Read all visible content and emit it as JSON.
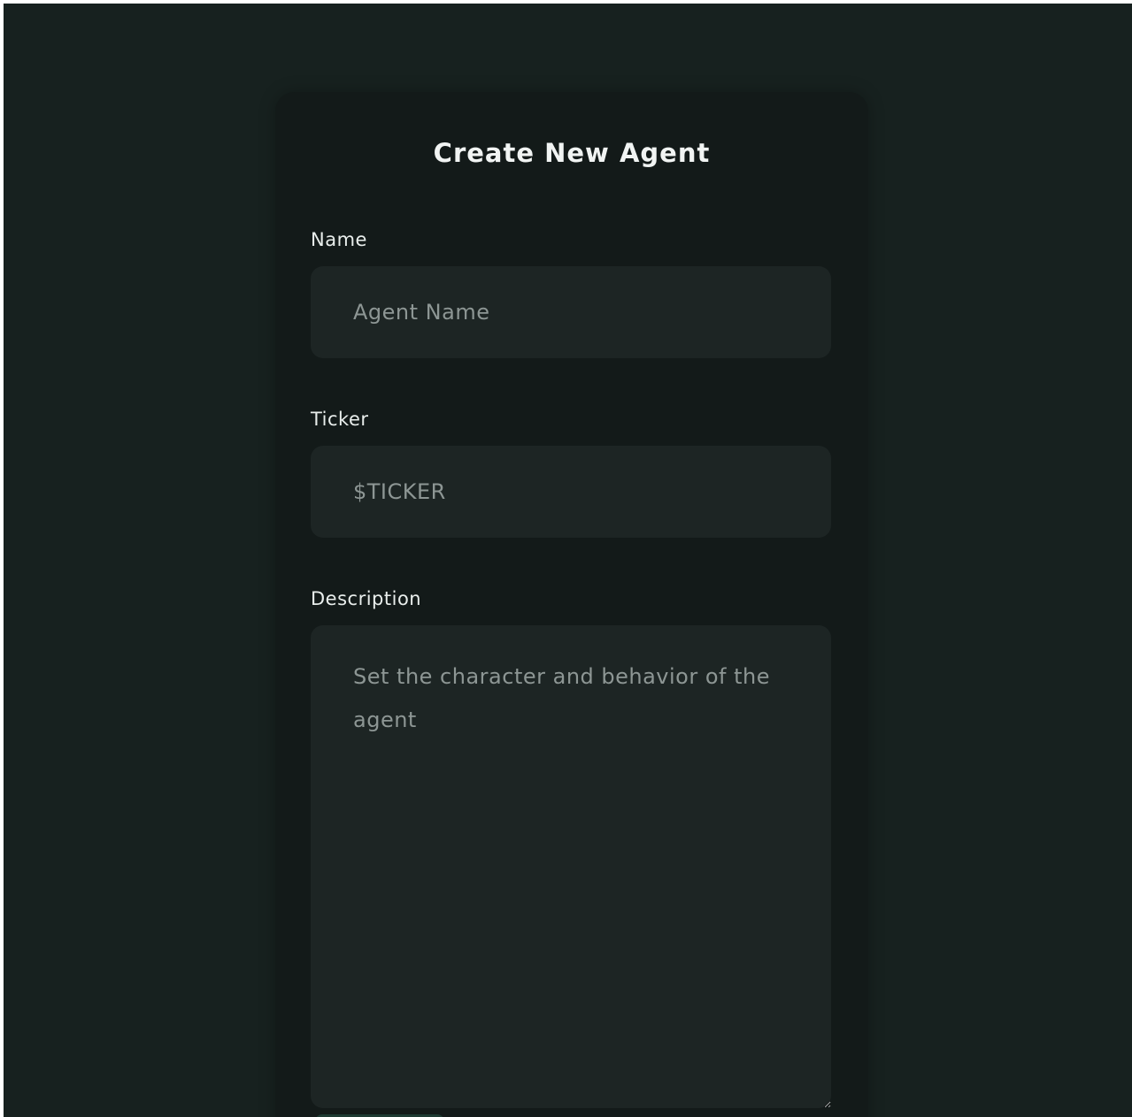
{
  "form": {
    "title": "Create New Agent",
    "name": {
      "label": "Name",
      "value": "",
      "placeholder": "Agent Name"
    },
    "ticker": {
      "label": "Ticker",
      "value": "",
      "placeholder": "$TICKER"
    },
    "description": {
      "label": "Description",
      "value": "",
      "placeholder": "Set the character and behavior of the agent"
    }
  },
  "colors": {
    "page_background": "#17211f",
    "card_background": "#131a19",
    "field_background": "#1d2524",
    "text": "#f1f4f3",
    "placeholder": "#8d9694",
    "accent": "#1e3a32"
  }
}
